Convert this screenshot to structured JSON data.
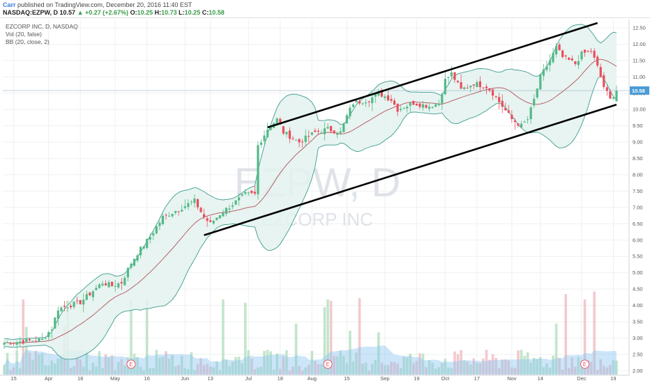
{
  "header": {
    "author": "Carr",
    "published_text": "published on TradingView.com, December 20, 2016 11:40 EST",
    "symbol": "NASDAQ:EZPW, D",
    "last": "10.57",
    "change_arrow": "▲",
    "change": "+0.27 (+2.67%)",
    "open_label": "O:",
    "open": "10.25",
    "high_label": "H:",
    "high": "10.73",
    "low_label": "L:",
    "low": "10.25",
    "close_label": "C:",
    "close": "10.58"
  },
  "legend": {
    "title": "EZCORP INC, D, NASDAQ",
    "vol": "Vol (20, false)",
    "bb": "BB (20, close, 2)"
  },
  "watermark": {
    "symbol": "EZPW, D",
    "name": "EZCORP INC"
  },
  "chart_data": {
    "type": "candlestick",
    "symbol": "EZPW",
    "ylim": [
      1.9,
      12.65
    ],
    "y_ticks": [
      "12.50",
      "12.00",
      "11.50",
      "11.00",
      "10.50",
      "10.00",
      "9.50",
      "9.00",
      "8.50",
      "8.00",
      "7.50",
      "7.00",
      "6.50",
      "6.00",
      "5.50",
      "5.00",
      "4.50",
      "4.00",
      "3.50",
      "3.00",
      "2.50",
      "2.00"
    ],
    "last_price_label": "10.58",
    "x_ticks": [
      {
        "label": "15",
        "i": 3
      },
      {
        "label": "Apr",
        "i": 14
      },
      {
        "label": "18",
        "i": 24
      },
      {
        "label": "May",
        "i": 35
      },
      {
        "label": "16",
        "i": 45
      },
      {
        "label": "Jun",
        "i": 57
      },
      {
        "label": "13",
        "i": 65
      },
      {
        "label": "Jul",
        "i": 77
      },
      {
        "label": "18",
        "i": 87
      },
      {
        "label": "Aug",
        "i": 97
      },
      {
        "label": "15",
        "i": 108
      },
      {
        "label": "Sep",
        "i": 120
      },
      {
        "label": "19",
        "i": 130
      },
      {
        "label": "Oct",
        "i": 139
      },
      {
        "label": "17",
        "i": 149
      },
      {
        "label": "Nov",
        "i": 160
      },
      {
        "label": "14",
        "i": 169
      },
      {
        "label": "Dec",
        "i": 182
      },
      {
        "label": "19",
        "i": 192
      }
    ],
    "earnings_markers": [
      {
        "i": 40,
        "label": "E"
      },
      {
        "i": 102,
        "label": "E"
      },
      {
        "i": 183,
        "label": "E"
      }
    ],
    "close_keypoints": [
      [
        0,
        2.85
      ],
      [
        6,
        2.9
      ],
      [
        12,
        2.95
      ],
      [
        15,
        3.3
      ],
      [
        17,
        3.9
      ],
      [
        24,
        4.1
      ],
      [
        31,
        4.7
      ],
      [
        34,
        4.6
      ],
      [
        37,
        4.7
      ],
      [
        40,
        5.3
      ],
      [
        42,
        5.6
      ],
      [
        46,
        6.1
      ],
      [
        50,
        6.7
      ],
      [
        56,
        7.0
      ],
      [
        60,
        7.2
      ],
      [
        63,
        6.7
      ],
      [
        65,
        6.5
      ],
      [
        68,
        6.8
      ],
      [
        72,
        7.1
      ],
      [
        76,
        7.4
      ],
      [
        79,
        7.4
      ],
      [
        80,
        8.9
      ],
      [
        83,
        9.4
      ],
      [
        86,
        9.7
      ],
      [
        88,
        9.3
      ],
      [
        93,
        9.0
      ],
      [
        98,
        9.3
      ],
      [
        102,
        9.4
      ],
      [
        106,
        9.3
      ],
      [
        108,
        9.8
      ],
      [
        110,
        10.2
      ],
      [
        115,
        10.3
      ],
      [
        118,
        10.5
      ],
      [
        122,
        10.3
      ],
      [
        124,
        10.0
      ],
      [
        129,
        10.2
      ],
      [
        134,
        10.1
      ],
      [
        137,
        10.2
      ],
      [
        139,
        10.9
      ],
      [
        141,
        11.1
      ],
      [
        144,
        10.6
      ],
      [
        148,
        10.8
      ],
      [
        152,
        10.7
      ],
      [
        154,
        10.5
      ],
      [
        157,
        10.1
      ],
      [
        160,
        9.7
      ],
      [
        163,
        9.5
      ],
      [
        165,
        9.7
      ],
      [
        167,
        10.3
      ],
      [
        169,
        11.0
      ],
      [
        172,
        11.5
      ],
      [
        174,
        11.9
      ],
      [
        176,
        11.6
      ],
      [
        180,
        11.4
      ],
      [
        182,
        11.7
      ],
      [
        185,
        11.8
      ],
      [
        187,
        11.3
      ],
      [
        189,
        10.7
      ],
      [
        191,
        10.3
      ],
      [
        193,
        10.58
      ]
    ],
    "volume_axis_fraction": true,
    "trend_channel": {
      "upper": [
        {
          "date": "Jul 12",
          "price": 9.45
        },
        {
          "date": "Dec 6",
          "price": 12.65
        }
      ],
      "lower": [
        {
          "date": "Jun 10",
          "price": 6.15
        },
        {
          "date": "Dec 19",
          "price": 10.15
        }
      ]
    }
  },
  "colors": {
    "up": "#53b987",
    "down": "#eb4d5c",
    "bb_line": "#3e9b8c",
    "bb_fill": "#e3f2ef",
    "basis": "#b4505a",
    "vol_ma": "#8fc6f0",
    "vol_up": "#b7e0c2",
    "vol_down": "#f1c0c5"
  }
}
